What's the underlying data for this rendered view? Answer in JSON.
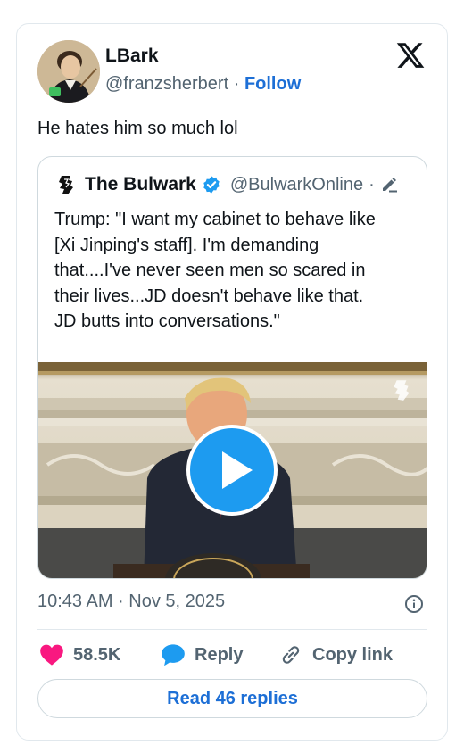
{
  "author": {
    "name": "LBark",
    "handle": "@franzsherbert",
    "separator": "·",
    "follow_label": "Follow"
  },
  "tweet_text": "He hates him so much lol",
  "quoted_tweet": {
    "name": "The Bulwark",
    "handle": "@BulwarkOnline",
    "separator": "·",
    "lines": [
      "Trump: \"I want my cabinet to behave like",
      "[Xi Jinping's staff]. I'm demanding",
      "that....I've never seen men so scared in",
      "their lives...JD doesn't behave like that.",
      "JD butts into conversations.\""
    ],
    "media": {
      "type": "video"
    }
  },
  "timestamp": "10:43 AM · Nov 5, 2025",
  "actions": {
    "likes": "58.5K",
    "reply": "Reply",
    "copy_link": "Copy link"
  },
  "read_replies": "Read 46 replies",
  "colors": {
    "accent": "#1d6fd6",
    "like": "#f91880",
    "reply": "#1d9bf0",
    "verified": "#1d9bf0",
    "muted": "#536471"
  },
  "icons": [
    "x-logo-icon",
    "bulwark-logo-icon",
    "verified-badge-icon",
    "pencil-icon",
    "play-icon",
    "info-icon",
    "heart-icon",
    "speech-bubble-icon",
    "link-icon"
  ]
}
